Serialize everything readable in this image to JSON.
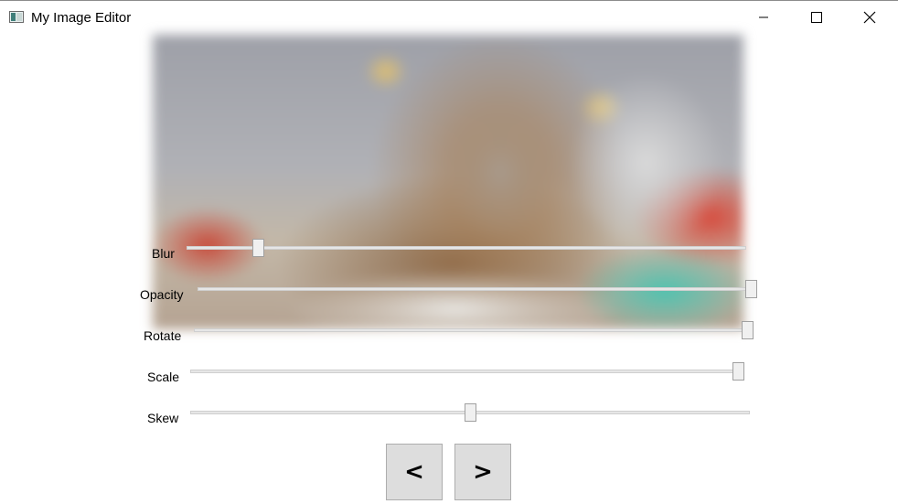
{
  "window": {
    "title": "My Image Editor",
    "minimize_icon": "minimize-icon",
    "maximize_icon": "maximize-icon",
    "close_icon": "close-icon"
  },
  "image": {
    "subject": "photo of a cat wearing a lion mane costume"
  },
  "sliders": [
    {
      "label": "Blur",
      "value": 0.12
    },
    {
      "label": "Opacity",
      "value": 1.0
    },
    {
      "label": "Rotate",
      "value": 1.0
    },
    {
      "label": "Scale",
      "value": 1.0
    },
    {
      "label": "Skew",
      "value": 0.5
    }
  ],
  "nav": {
    "prev_label": "<",
    "next_label": ">"
  }
}
